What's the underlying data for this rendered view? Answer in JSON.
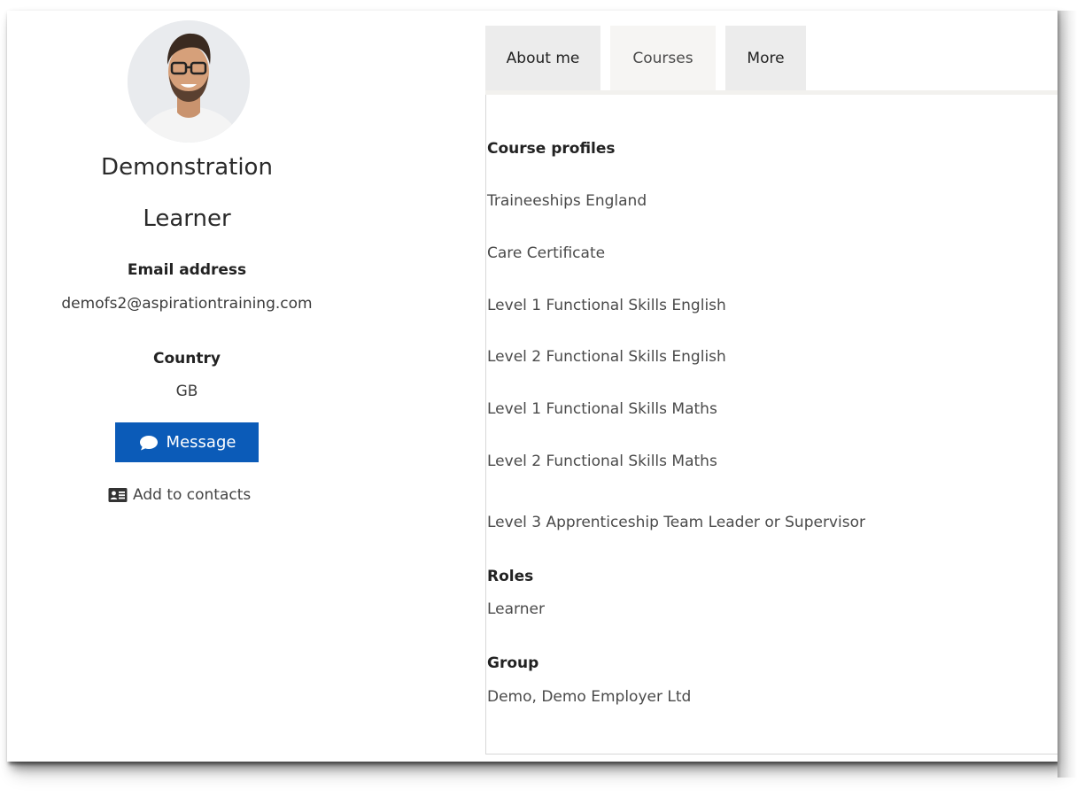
{
  "profile": {
    "name_line1": "Demonstration",
    "name_line2": "Learner",
    "email_label": "Email address",
    "email_value": "demofs2@aspirationtraining.com",
    "country_label": "Country",
    "country_value": "GB",
    "message_button": "Message",
    "add_contacts": "Add to contacts"
  },
  "tabs": [
    {
      "label": "About me",
      "active": false
    },
    {
      "label": "Courses",
      "active": true
    },
    {
      "label": "More",
      "active": false
    }
  ],
  "courses": {
    "profiles_heading": "Course profiles",
    "items": [
      "Traineeships  England",
      "Care Certificate",
      "Level 1  Functional Skills  English",
      "Level 2  Functional Skills  English",
      "Level 1  Functional Skills  Maths",
      "Level 2  Functional Skills  Maths",
      "Level 3 Apprenticeship Team  Leader or Supervisor"
    ],
    "roles_heading": "Roles",
    "roles_value": "Learner",
    "group_heading": "Group",
    "group_value": "Demo,  Demo  Employer  Ltd"
  },
  "icons": {
    "message": "speech-bubble-icon",
    "contacts": "address-card-icon"
  },
  "colors": {
    "message_button": "#0b5bb8",
    "tab_bg": "#ececec",
    "tab_active_bg": "#f6f5f3"
  }
}
